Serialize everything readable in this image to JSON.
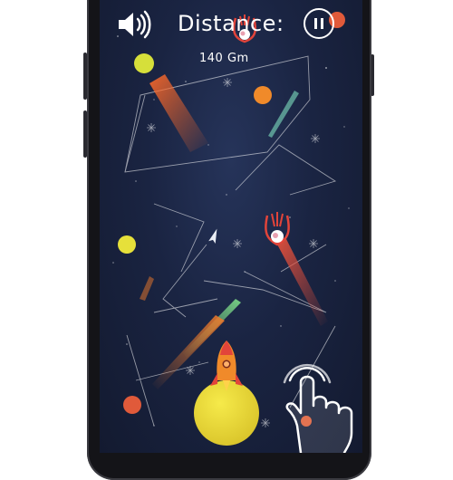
{
  "hud": {
    "sound_icon": "speaker-icon",
    "distance_label": "Distance:",
    "distance_value": "140 Gm",
    "pause_icon": "pause-icon"
  },
  "scene": {
    "player": "rocket",
    "gesture_hint": "tap-hand-icon"
  },
  "colors": {
    "background": "#1a2442",
    "planet_yellow": "#f2e23a",
    "rocket_orange": "#f08a2a",
    "comet_red": "#e2443a"
  }
}
